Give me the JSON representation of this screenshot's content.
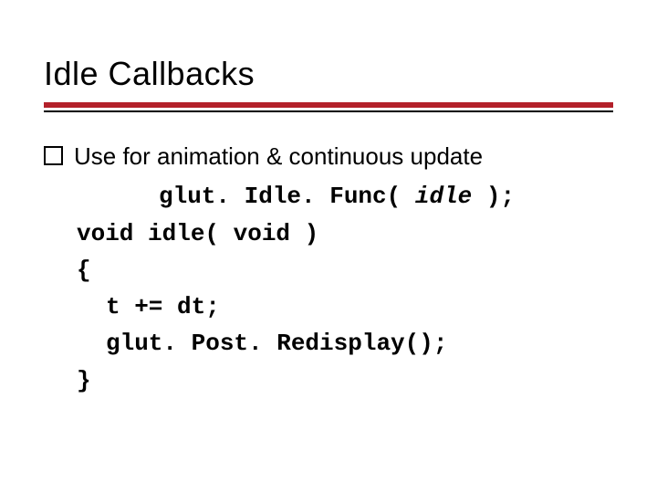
{
  "title": "Idle Callbacks",
  "bullet": "Use for animation & continuous update",
  "code": {
    "call_pre": "glut. Idle. Func( ",
    "call_param": "idle",
    "call_post": " );",
    "sig": "void idle( void )",
    "open": "{",
    "l1": "t += dt;",
    "l2": "glut. Post. Redisplay();",
    "close": "}"
  }
}
